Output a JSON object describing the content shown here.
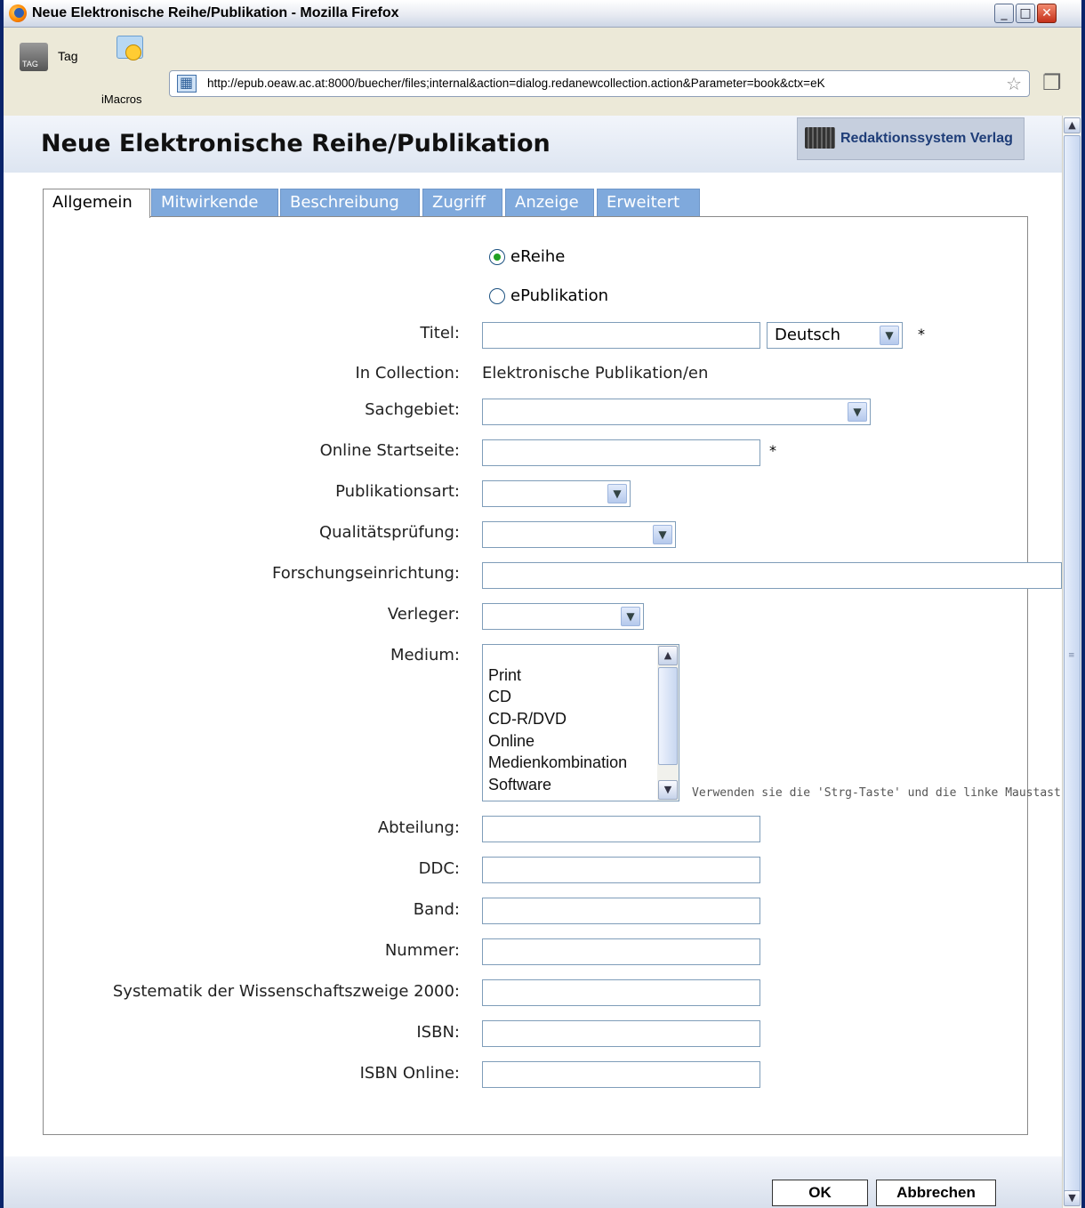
{
  "window": {
    "title": "Neue Elektronische Reihe/Publikation - Mozilla Firefox"
  },
  "toolbar": {
    "tag_label": "Tag",
    "imacros_label": "iMacros",
    "url": "http://epub.oeaw.ac.at:8000/buecher/files;internal&action=dialog.redanewcollection.action&Parameter=book&ctx=eK"
  },
  "dialog": {
    "title": "Neue Elektronische Reihe/Publikation",
    "brand": "Redaktionssystem Verlag"
  },
  "tabs": [
    {
      "label": "Allgemein",
      "active": true
    },
    {
      "label": "Mitwirkende",
      "active": false
    },
    {
      "label": "Beschreibung",
      "active": false
    },
    {
      "label": "Zugriff",
      "active": false
    },
    {
      "label": "Anzeige",
      "active": false
    },
    {
      "label": "Erweitert",
      "active": false
    }
  ],
  "form": {
    "type_options": [
      {
        "label": "eReihe",
        "checked": true
      },
      {
        "label": "ePublikation",
        "checked": false
      }
    ],
    "titel_label": "Titel:",
    "titel_value": "",
    "titel_lang": "Deutsch",
    "required_mark": "*",
    "collection_label": "In Collection:",
    "collection_value": "Elektronische Publikation/en",
    "sachgebiet_label": "Sachgebiet:",
    "startseite_label": "Online Startseite:",
    "publikationsart_label": "Publikationsart:",
    "qualitaet_label": "Qualitätsprüfung:",
    "forschung_label": "Forschungseinrichtung:",
    "verleger_label": "Verleger:",
    "medium_label": "Medium:",
    "medium_options": [
      "Print",
      "CD",
      "CD-R/DVD",
      "Online",
      "Medienkombination",
      "Software"
    ],
    "medium_hint": "Verwenden sie die 'Strg-Taste' und die linke Maustast",
    "abteilung_label": "Abteilung:",
    "ddc_label": "DDC:",
    "band_label": "Band:",
    "nummer_label": "Nummer:",
    "systematik_label": "Systematik der Wissenschaftszweige 2000:",
    "isbn_label": "ISBN:",
    "isbn_online_label": "ISBN Online:"
  },
  "footer": {
    "ok_label": "OK",
    "cancel_label": "Abbrechen"
  },
  "icons": {
    "firefox": "firefox-logo-icon",
    "tag": "tag-icon",
    "imacros": "imacros-icon",
    "site": "site-identity-icon",
    "bookmark": "bookmark-star-icon"
  }
}
